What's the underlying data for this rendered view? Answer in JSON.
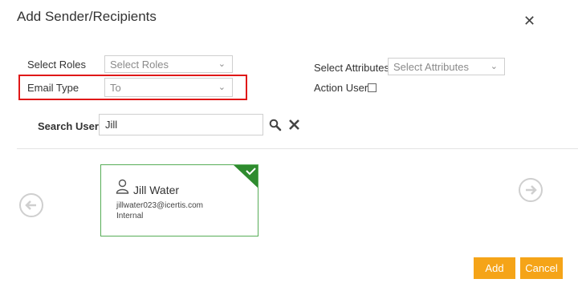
{
  "dialog": {
    "title": "Add Sender/Recipients"
  },
  "filters": {
    "roles_label": "Select Roles",
    "roles_value": "Select Roles",
    "email_type_label": "Email Type",
    "email_type_value": "To",
    "attributes_label": "Select Attributes",
    "attributes_value": "Select Attributes",
    "action_user_label": "Action User",
    "action_user_checked": false
  },
  "search": {
    "label": "Search User",
    "value": "Jill"
  },
  "result_card": {
    "name": "Jill Water",
    "email": "jillwater023@icertis.com",
    "type": "Internal",
    "selected": true
  },
  "footer": {
    "add_label": "Add",
    "cancel_label": "Cancel"
  },
  "colors": {
    "accent": "#f5a418",
    "selected_green": "#2e8b2e",
    "highlight_red": "#e01818"
  }
}
